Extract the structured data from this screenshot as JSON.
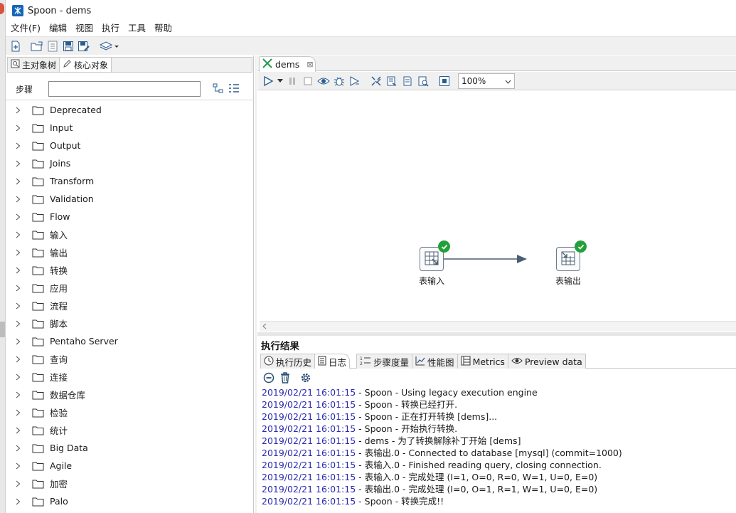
{
  "window": {
    "title": "Spoon - dems"
  },
  "menu": [
    "文件(F)",
    "编辑",
    "视图",
    "执行",
    "工具",
    "帮助"
  ],
  "toolbar": {
    "buttons": [
      "new-file-icon",
      "open-icon",
      "explore-repo-icon",
      "save-icon",
      "save-as-icon",
      "perspective-layers-icon"
    ]
  },
  "left_panel": {
    "tabs": [
      {
        "label": "主对象树",
        "icon": "search-tree-icon",
        "active": false
      },
      {
        "label": "核心对象",
        "icon": "pencil-icon",
        "active": true
      }
    ],
    "steps_label": "步骤",
    "search_value": "",
    "tree": [
      "Deprecated",
      "Input",
      "Output",
      "Joins",
      "Transform",
      "Validation",
      "Flow",
      "输入",
      "输出",
      "转换",
      "应用",
      "流程",
      "脚本",
      "Pentaho Server",
      "查询",
      "连接",
      "数据仓库",
      "检验",
      "统计",
      "Big Data",
      "Agile",
      "加密",
      "Palo"
    ]
  },
  "editor": {
    "tab_label": "dems",
    "zoom": "100%",
    "steps": [
      {
        "label": "表输入",
        "status": "ok"
      },
      {
        "label": "表输出",
        "status": "ok"
      }
    ]
  },
  "results": {
    "title": "执行结果",
    "tabs": [
      {
        "label": "执行历史",
        "icon": "history-icon",
        "active": false
      },
      {
        "label": "日志",
        "icon": "log-icon",
        "active": true
      },
      {
        "label": "步骤度量",
        "icon": "step-metrics-icon",
        "active": false
      },
      {
        "label": "性能图",
        "icon": "performance-graph-icon",
        "active": false
      },
      {
        "label": "Metrics",
        "icon": "metrics-icon",
        "active": false
      },
      {
        "label": "Preview data",
        "icon": "eye-icon",
        "active": false
      }
    ],
    "log": [
      {
        "ts": "2019/02/21 16:01:15",
        "msg": " - Spoon - Using legacy execution engine"
      },
      {
        "ts": "2019/02/21 16:01:15",
        "msg": " - Spoon - 转换已经打开."
      },
      {
        "ts": "2019/02/21 16:01:15",
        "msg": " - Spoon - 正在打开转换 [dems]..."
      },
      {
        "ts": "2019/02/21 16:01:15",
        "msg": " - Spoon - 开始执行转换."
      },
      {
        "ts": "2019/02/21 16:01:15",
        "msg": " - dems - 为了转换解除补丁开始  [dems]"
      },
      {
        "ts": "2019/02/21 16:01:15",
        "msg": " - 表输出.0 - Connected to database [mysql] (commit=1000)"
      },
      {
        "ts": "2019/02/21 16:01:15",
        "msg": " - 表输入.0 - Finished reading query, closing connection."
      },
      {
        "ts": "2019/02/21 16:01:15",
        "msg": " - 表输入.0 - 完成处理 (I=1, O=0, R=0, W=1, U=0, E=0)"
      },
      {
        "ts": "2019/02/21 16:01:15",
        "msg": " - 表输出.0 - 完成处理 (I=0, O=1, R=1, W=1, U=0, E=0)"
      },
      {
        "ts": "2019/02/21 16:01:15",
        "msg": " - Spoon - 转换完成!!"
      }
    ]
  }
}
